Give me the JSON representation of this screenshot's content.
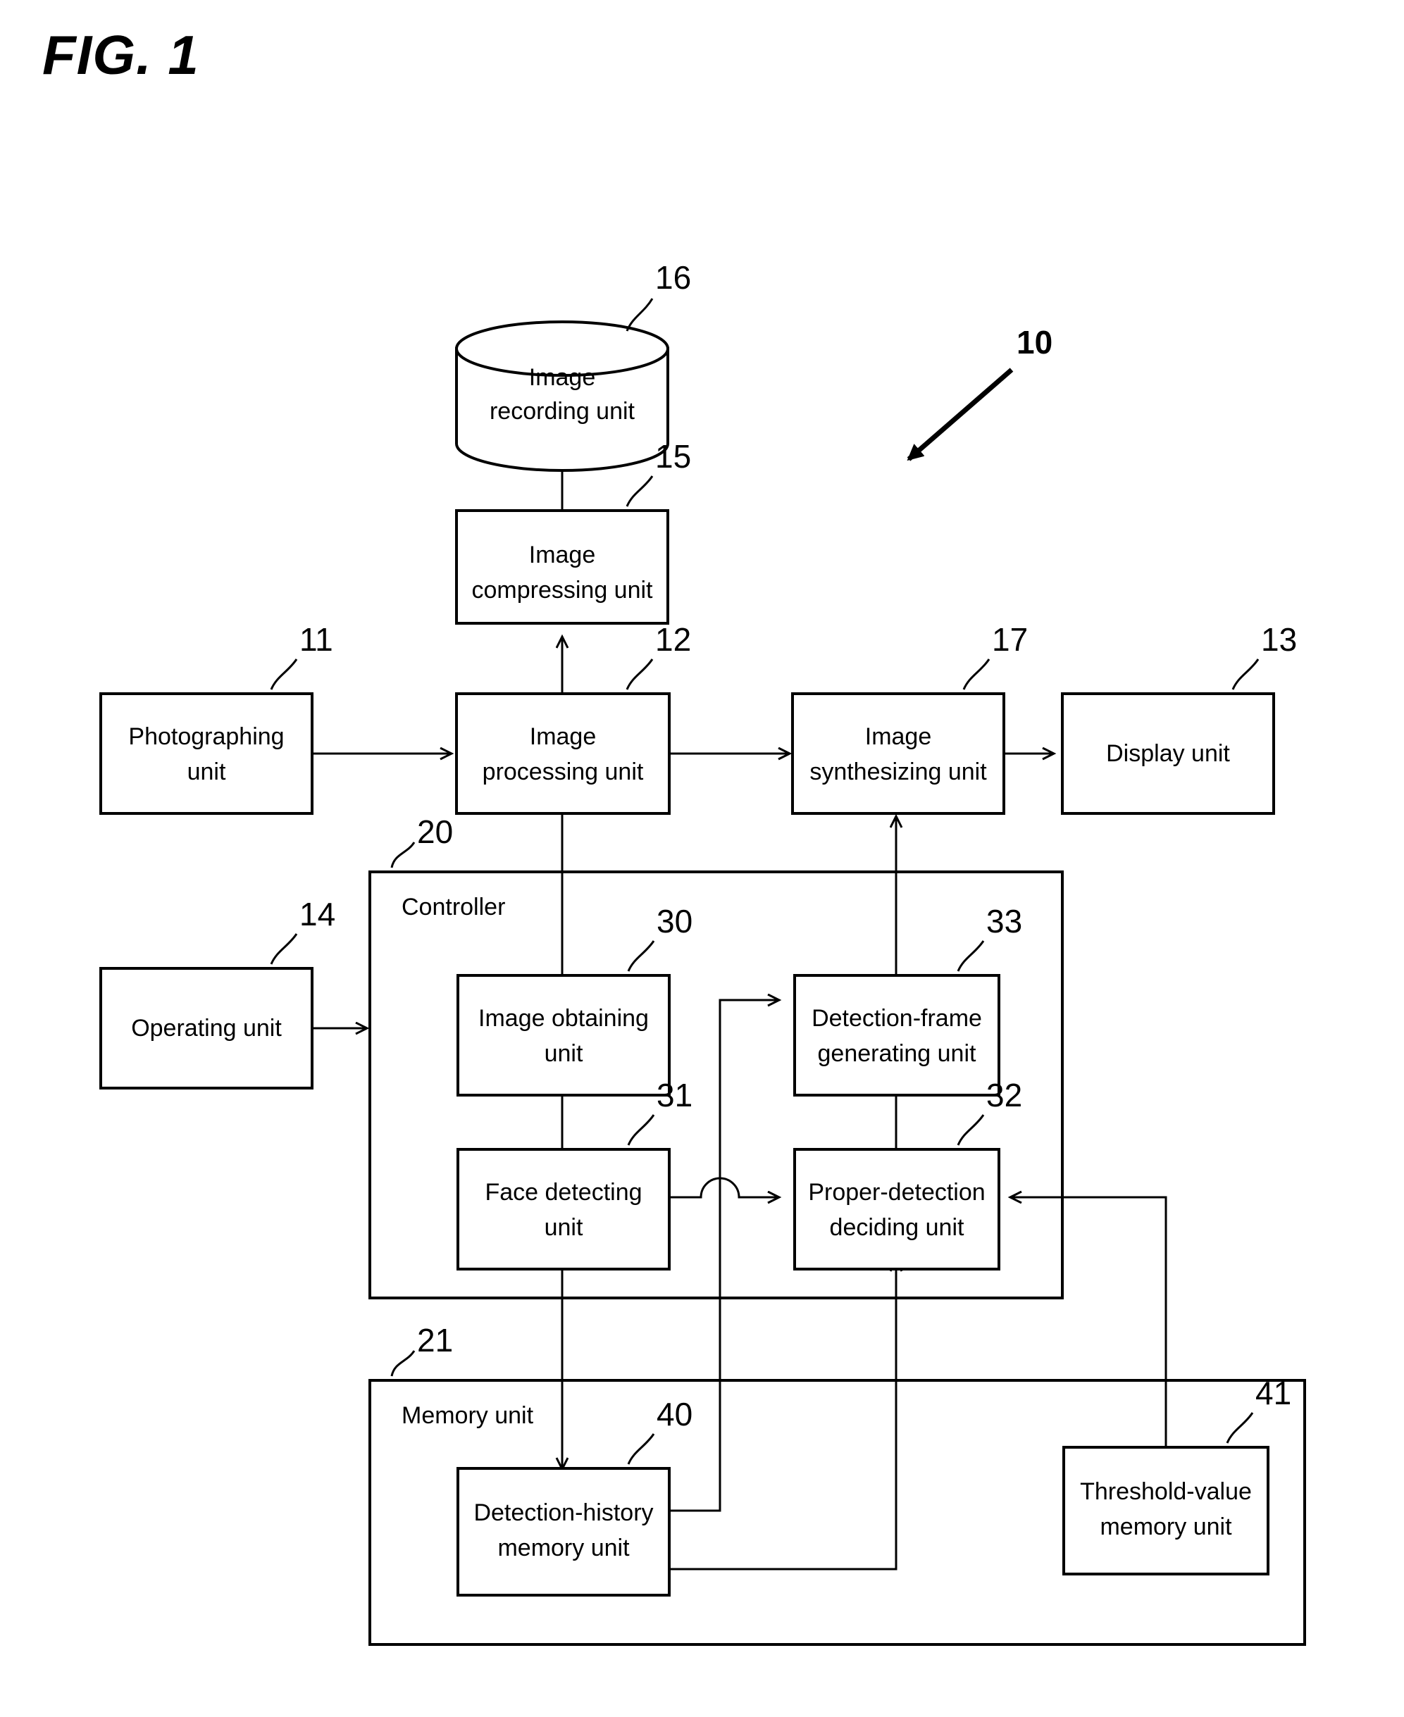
{
  "figure": {
    "title": "FIG. 1",
    "system_ref": "10"
  },
  "blocks": [
    {
      "id": "image_recording",
      "label_lines": [
        "Image",
        "recording unit"
      ],
      "ref": "16",
      "shape": "cylinder"
    },
    {
      "id": "image_compressing",
      "label_lines": [
        "Image",
        "compressing unit"
      ],
      "ref": "15",
      "shape": "rect"
    },
    {
      "id": "photographing",
      "label_lines": [
        "Photographing",
        "unit"
      ],
      "ref": "11",
      "shape": "rect"
    },
    {
      "id": "image_processing",
      "label_lines": [
        "Image",
        "processing unit"
      ],
      "ref": "12",
      "shape": "rect"
    },
    {
      "id": "image_synthesizing",
      "label_lines": [
        "Image",
        "synthesizing unit"
      ],
      "ref": "17",
      "shape": "rect"
    },
    {
      "id": "display",
      "label_lines": [
        "Display unit"
      ],
      "ref": "13",
      "shape": "rect"
    },
    {
      "id": "operating",
      "label_lines": [
        "Operating unit"
      ],
      "ref": "14",
      "shape": "rect"
    },
    {
      "id": "image_obtaining",
      "label_lines": [
        "Image obtaining",
        "unit"
      ],
      "ref": "30",
      "shape": "rect"
    },
    {
      "id": "face_detecting",
      "label_lines": [
        "Face detecting",
        "unit"
      ],
      "ref": "31",
      "shape": "rect"
    },
    {
      "id": "detection_frame_generating",
      "label_lines": [
        "Detection-frame",
        "generating unit"
      ],
      "ref": "33",
      "shape": "rect"
    },
    {
      "id": "proper_detection_deciding",
      "label_lines": [
        "Proper-detection",
        "deciding unit"
      ],
      "ref": "32",
      "shape": "rect"
    },
    {
      "id": "detection_history_memory",
      "label_lines": [
        "Detection-history",
        "memory unit"
      ],
      "ref": "40",
      "shape": "rect"
    },
    {
      "id": "threshold_value_memory",
      "label_lines": [
        "Threshold-value",
        "memory unit"
      ],
      "ref": "41",
      "shape": "rect"
    }
  ],
  "groups": [
    {
      "id": "controller",
      "label": "Controller",
      "ref": "20"
    },
    {
      "id": "memory_unit",
      "label": "Memory unit",
      "ref": "21"
    }
  ],
  "labels": {
    "image_recording_l1": "Image",
    "image_recording_l2": "recording unit",
    "image_recording_ref": "16",
    "image_compressing_l1": "Image",
    "image_compressing_l2": "compressing unit",
    "image_compressing_ref": "15",
    "photographing_l1": "Photographing",
    "photographing_l2": "unit",
    "photographing_ref": "11",
    "image_processing_l1": "Image",
    "image_processing_l2": "processing unit",
    "image_processing_ref": "12",
    "image_synthesizing_l1": "Image",
    "image_synthesizing_l2": "synthesizing unit",
    "image_synthesizing_ref": "17",
    "display_l1": "Display unit",
    "display_ref": "13",
    "operating_l1": "Operating unit",
    "operating_ref": "14",
    "controller_label": "Controller",
    "controller_ref": "20",
    "image_obtaining_l1": "Image obtaining",
    "image_obtaining_l2": "unit",
    "image_obtaining_ref": "30",
    "face_detecting_l1": "Face detecting",
    "face_detecting_l2": "unit",
    "face_detecting_ref": "31",
    "detection_frame_l1": "Detection-frame",
    "detection_frame_l2": "generating unit",
    "detection_frame_ref": "33",
    "proper_detection_l1": "Proper-detection",
    "proper_detection_l2": "deciding unit",
    "proper_detection_ref": "32",
    "memory_unit_label": "Memory unit",
    "memory_unit_ref": "21",
    "detection_history_l1": "Detection-history",
    "detection_history_l2": "memory unit",
    "detection_history_ref": "40",
    "threshold_value_l1": "Threshold-value",
    "threshold_value_l2": "memory unit",
    "threshold_value_ref": "41",
    "system_ref": "10",
    "figure_title": "FIG. 1"
  },
  "connections": [
    {
      "from": "photographing",
      "to": "image_processing",
      "style": "arrow"
    },
    {
      "from": "image_processing",
      "to": "image_compressing",
      "style": "arrow"
    },
    {
      "from": "image_compressing",
      "to": "image_recording",
      "style": "arrow"
    },
    {
      "from": "image_processing",
      "to": "image_synthesizing",
      "style": "arrow"
    },
    {
      "from": "image_synthesizing",
      "to": "display",
      "style": "arrow"
    },
    {
      "from": "operating",
      "to": "controller",
      "style": "arrow"
    },
    {
      "from": "image_processing",
      "to": "image_obtaining",
      "style": "line"
    },
    {
      "from": "image_obtaining",
      "to": "face_detecting",
      "style": "line"
    },
    {
      "from": "face_detecting",
      "to": "proper_detection_deciding",
      "style": "arrow-with-hop"
    },
    {
      "from": "face_detecting",
      "to": "detection_history_memory",
      "style": "arrow"
    },
    {
      "from": "proper_detection_deciding",
      "to": "detection_frame_generating",
      "style": "arrow"
    },
    {
      "from": "detection_frame_generating",
      "to": "image_synthesizing",
      "style": "arrow"
    },
    {
      "from": "detection_history_memory",
      "to": "detection_frame_generating",
      "style": "arrow"
    },
    {
      "from": "detection_history_memory",
      "to": "proper_detection_deciding",
      "style": "arrow"
    },
    {
      "from": "threshold_value_memory",
      "to": "proper_detection_deciding",
      "style": "arrow"
    }
  ],
  "colors": {
    "stroke": "#000000",
    "fill": "#ffffff"
  }
}
